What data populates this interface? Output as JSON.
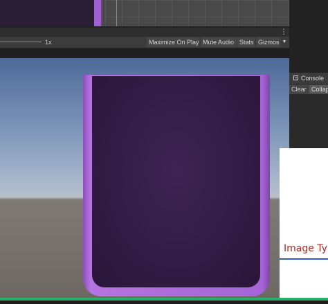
{
  "game_toolbar": {
    "scale_value": "1x",
    "maximize_label": "Maximize On Play",
    "mute_label": "Mute Audio",
    "stats_label": "Stats",
    "gizmos_label": "Gizmos",
    "menu_glyph": "⋮",
    "gizmos_arrow": "▼"
  },
  "console": {
    "title": "Console",
    "clear_label": "Clear",
    "collapse_label": "Collapse"
  },
  "popup": {
    "heading": "Image Typ"
  },
  "colors": {
    "sky_top": "#4d6a99",
    "ground": "#79736d",
    "panel_frame": "#a565d6",
    "panel_inner": "#321c45",
    "progress_bar": "#2fae6a",
    "heading_red": "#b3261e",
    "underline_blue": "#2f5fb0"
  }
}
